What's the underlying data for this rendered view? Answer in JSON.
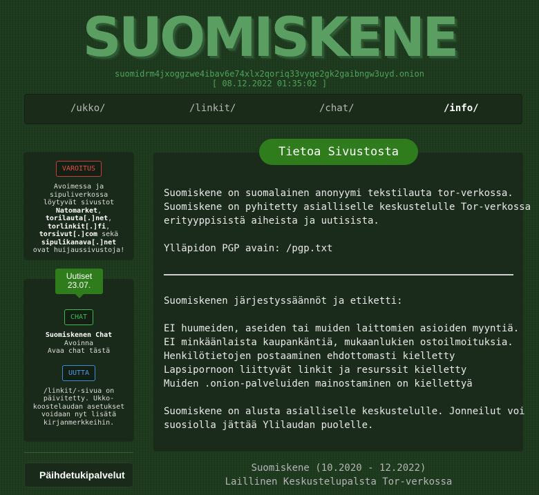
{
  "site": {
    "logo": "SUOMISKENE",
    "onion": "suomidrm4jxoggzwe4ibav6e74xlx2qoriq33vyqe2gk2gaibngw3uyd.onion",
    "datetime": "[ 08.12.2022 01:35:02 ]"
  },
  "nav": [
    {
      "label": "/ukko/"
    },
    {
      "label": "/linkit/"
    },
    {
      "label": "/chat/"
    },
    {
      "label": "/info/"
    }
  ],
  "sidebar": {
    "warning": {
      "tag": "VAROITUS",
      "line1": "Avoimessa ja",
      "line2": "sipuliverkossa",
      "line3": "löytyvät sivustot",
      "site1": "Natomarket",
      "site2": "torilauta[.]net",
      "site3": "torlinkit[.]fi",
      "site4": "torsivut[.]com",
      "and": "sekä",
      "site5": "sipulikanava[.]net",
      "end": "ovat huijaussivustoja!"
    },
    "news": {
      "badge_title": "Uutiset",
      "badge_date": "23.07.",
      "chat_tag": "CHAT",
      "chat_title": "Suomiskenen Chat",
      "chat_line2": "Avoinna",
      "chat_line3": "Avaa chat tästä",
      "new_tag": "UUTTA",
      "new_line1": "/linkit/-sivua on",
      "new_line2": "päivitetty. Ukko-",
      "new_line3": "koostelaudan asetukset",
      "new_line4": "voidaan nyt lisätä",
      "new_line5": "kirjanmerkkeihin."
    },
    "service_button": "Päihdetukipalvelut"
  },
  "main": {
    "title": "Tietoa Sivustosta",
    "intro1": "Suomiskene on suomalainen anonyymi tekstilauta tor-verkossa.",
    "intro2": "Suomiskene on pyhitetty asialliselle keskustelulle Tor-verkossa",
    "intro3": "erityyppisistä aiheista ja uutisista.",
    "pgp": "Ylläpidon PGP avain: /pgp.txt",
    "rules_title": "Suomiskenen järjestyssäännöt ja etiketti:",
    "rules": [
      "EI huumeiden, aseiden tai muiden laittomien asioiden myyntiä.",
      "EI minkäänlaista kaupankäntiä, mukaanlukien ostoilmoituksia.",
      "Henkilötietojen postaaminen ehdottomasti kielletty",
      "Lapsipornoon liittyvät linkit ja resurssit kielletty",
      "Muiden .onion-palveluiden mainostaminen on kiellettyä"
    ],
    "closing1": "Suomiskene on alusta asialliselle keskustelulle. Jonneilut voi",
    "closing2": "suosiolla jättää Ylilaudan puolelle."
  },
  "footer": {
    "line1": "Suomiskene (10.2020 - 12.2022)",
    "line2": "Laillinen Keskustelupalsta Tor-verkossa"
  },
  "colors": {
    "background": "#1e3a1e",
    "accent": "#2f7c1c",
    "warning_red": "#d9453d",
    "chat_green": "#3fb950",
    "new_blue": "#3a8fd8"
  }
}
